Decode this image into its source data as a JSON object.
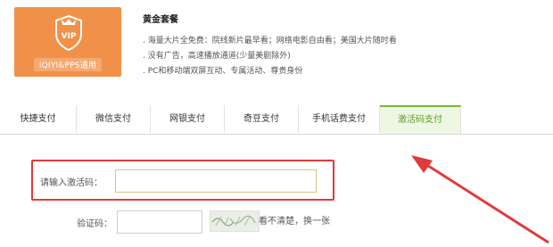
{
  "package": {
    "vip_text": "VIP",
    "vip_subtitle": "iQIYI&PPS通用",
    "title": "黄金套餐",
    "features": [
      ". 海量大片全免费：院线新片最早看；网络电影自由看；美国大片随时看",
      ". 没有广告，高速播放通道(少量美剧除外)",
      ". PC和移动端双屏互动、专属活动、尊贵身份"
    ]
  },
  "tabs": [
    {
      "label": "快捷支付",
      "active": false
    },
    {
      "label": "微信支付",
      "active": false
    },
    {
      "label": "网银支付",
      "active": false
    },
    {
      "label": "奇豆支付",
      "active": false
    },
    {
      "label": "手机话费支付",
      "active": false
    },
    {
      "label": "激活码支付",
      "active": true
    }
  ],
  "form": {
    "activation_label": "请输入激活码：",
    "activation_value": "",
    "verify_label": "验证码：",
    "verify_value": "",
    "captcha_hint": "看不清楚，换一张"
  },
  "colors": {
    "vip_orange": "#f19149",
    "active_tab_green": "#7ab83a",
    "highlight_red": "#e23a3a"
  }
}
